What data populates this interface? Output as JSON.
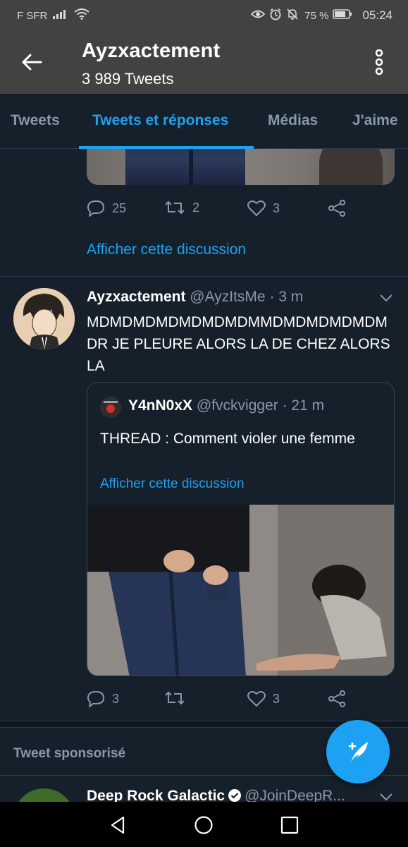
{
  "status_bar": {
    "carrier": "F SFR",
    "battery": "75 %",
    "time": "05:24"
  },
  "header": {
    "title": "Ayzxactement",
    "subtitle": "3 989 Tweets"
  },
  "tabs": [
    {
      "label": "Tweets",
      "active": false
    },
    {
      "label": "Tweets et réponses",
      "active": true
    },
    {
      "label": "Médias",
      "active": false
    },
    {
      "label": "J'aime",
      "active": false
    }
  ],
  "feed": {
    "prev_tweet": {
      "reply_count": "25",
      "retweet_count": "2",
      "like_count": "3",
      "show_thread": "Afficher cette discussion"
    },
    "tweet": {
      "name": "Ayzxactement",
      "handle": "@AyzItsMe",
      "time": "· 3 m",
      "text": "MDMDMDMDMDMDMDMMDMDMDMDMDMDR JE PLEURE ALORS LA DE CHEZ ALORS LA",
      "quote": {
        "name": "Y4nN0xX",
        "handle": "@fvckvigger",
        "time": "· 21 m",
        "text": "THREAD : Comment violer une femme",
        "show_thread": "Afficher cette discussion"
      },
      "reply_count": "3",
      "retweet_count": "",
      "like_count": "3"
    },
    "sponsored": {
      "label": "Tweet sponsorisé",
      "name": "Deep Rock Galactic",
      "handle": "@JoinDeepR..."
    }
  },
  "colors": {
    "background": "#15202b",
    "accent": "#1da1f2",
    "secondary_text": "#8899a6",
    "header": "#424242"
  },
  "icons": {
    "back": "arrow-left-icon",
    "overflow": "more-vertical-icon",
    "reply": "reply-icon",
    "retweet": "retweet-icon",
    "like": "heart-icon",
    "share": "share-icon",
    "compose": "compose-tweet-icon"
  }
}
